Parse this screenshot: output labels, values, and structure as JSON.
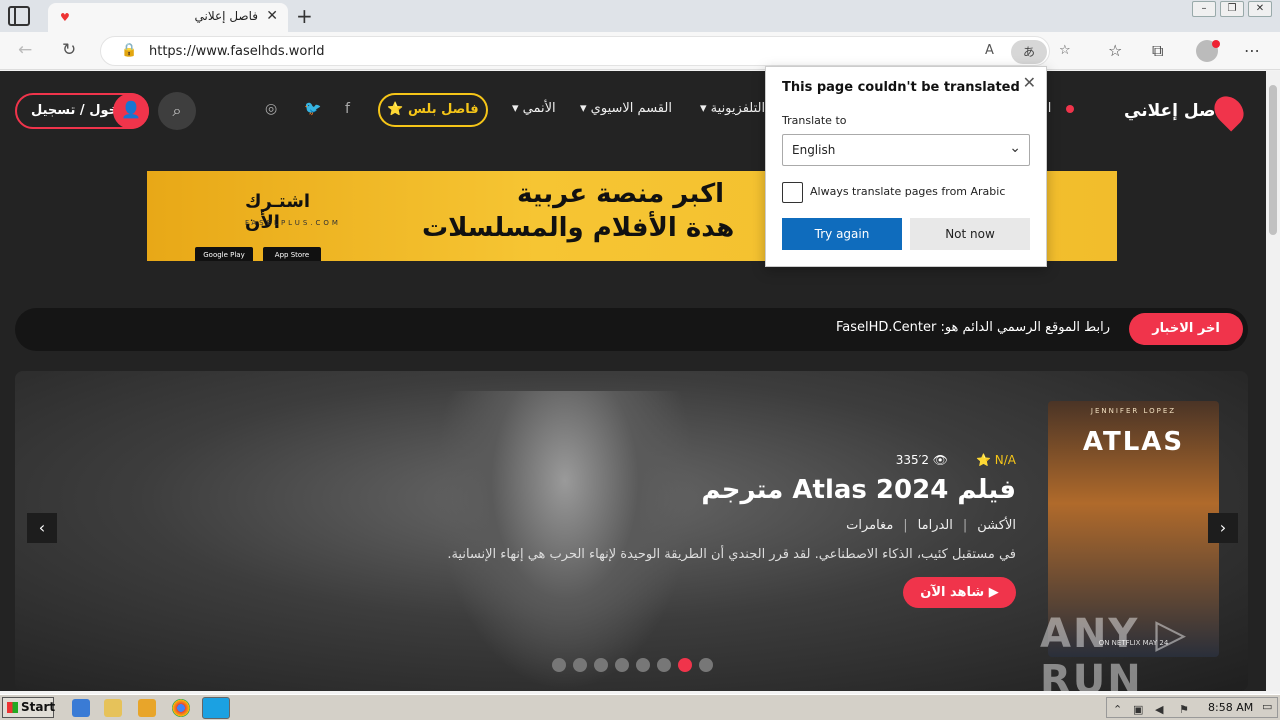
{
  "browser": {
    "tab_title": "فاصل إعلاني",
    "url": "https://www.faselhds.world",
    "translate_pill": "あ"
  },
  "site": {
    "login_label": "دخول / تسجيل",
    "plus_label": "⭐ فاصل بلس",
    "logo_text": "فاصل إعلاني",
    "menu": [
      "الأنمي",
      "القسم الاسيوي",
      "التلفزيونية",
      "الـ"
    ],
    "banner": {
      "cta_title": "اشتـرك الأن",
      "cta_url": "FASELPLUS.COM",
      "google_play": "Google Play",
      "app_store": "App Store",
      "line1": "اكبر منصة عربية",
      "line2": "هدة الأفلام والمسلسلات"
    },
    "news": {
      "label": "اخر الاخبار",
      "text": "رابط الموقع الرسمي الدائم هو: FaselHD.Center"
    },
    "hero": {
      "rating": "⭐ N/A",
      "views": "335‎′2 👁",
      "title": "فيلم Atlas 2024 مترجم",
      "genres": [
        "الأكشن",
        "الدراما",
        "مغامرات"
      ],
      "description": "في مستقبل كئيب، الذكاء الاصطناعي. لقد قرر الجندي أن الطريقة الوحيدة لإنهاء الحرب هي إنهاء الإنسانية.",
      "watch_label": "▶ شاهد الآن",
      "poster_top": "JENNIFER LOPEZ",
      "poster_title": "ATLAS",
      "poster_bottom": "ON NETFLIX   MAY 24",
      "slides_total": 8,
      "active_slide": 7,
      "watermark": "ANY ▷ RUN"
    }
  },
  "translate_popup": {
    "title": "This page couldn't be translated",
    "translate_to_label": "Translate to",
    "language": "English",
    "checkbox_label": "Always translate pages from Arabic",
    "try_again": "Try again",
    "not_now": "Not now"
  },
  "taskbar": {
    "start_label": "Start",
    "clock": "8:58 AM"
  }
}
